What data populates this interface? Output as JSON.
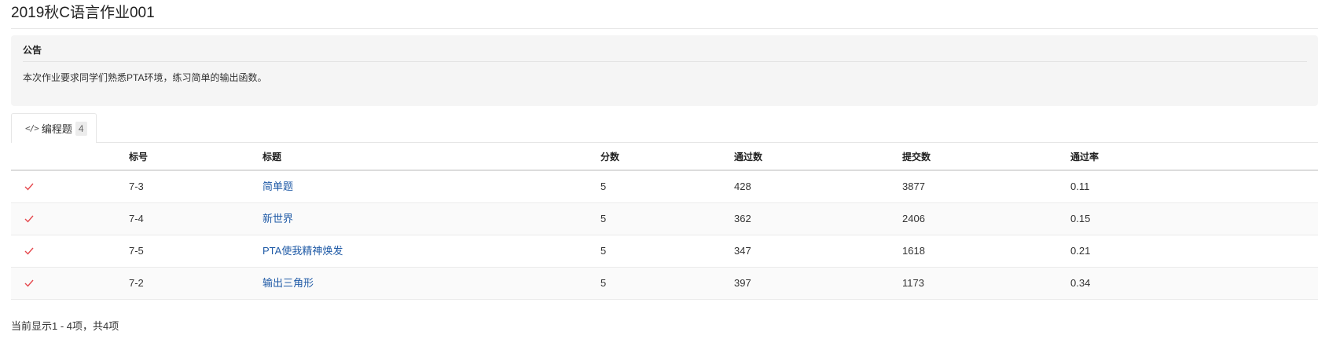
{
  "page": {
    "title": "2019秋C语言作业001"
  },
  "notice": {
    "title": "公告",
    "body": "本次作业要求同学们熟悉PTA环境，练习简单的输出函数。"
  },
  "tabs": [
    {
      "icon": "code-icon",
      "label": "编程题",
      "count": "4"
    }
  ],
  "table": {
    "headers": {
      "number": "标号",
      "title": "标题",
      "score": "分数",
      "passed": "通过数",
      "submitted": "提交数",
      "rate": "通过率"
    },
    "rows": [
      {
        "number": "7-3",
        "title": "简单题",
        "score": "5",
        "passed": "428",
        "submitted": "3877",
        "rate": "0.11",
        "status": "checkmark-icon"
      },
      {
        "number": "7-4",
        "title": "新世界",
        "score": "5",
        "passed": "362",
        "submitted": "2406",
        "rate": "0.15",
        "status": "checkmark-icon"
      },
      {
        "number": "7-5",
        "title": "PTA使我精神焕发",
        "score": "5",
        "passed": "347",
        "submitted": "1618",
        "rate": "0.21",
        "status": "checkmark-icon"
      },
      {
        "number": "7-2",
        "title": "输出三角形",
        "score": "5",
        "passed": "397",
        "submitted": "1173",
        "rate": "0.34",
        "status": "checkmark-icon"
      }
    ]
  },
  "colors": {
    "check": "#e5484d",
    "link": "#1f5aa6"
  },
  "footer": {
    "summary": "当前显示1 - 4项，共4项"
  }
}
